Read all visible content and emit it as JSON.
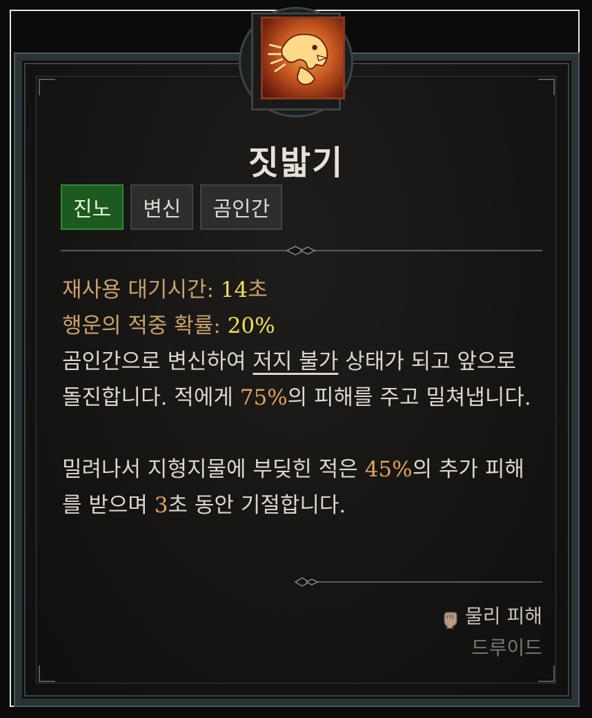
{
  "skill": {
    "name": "짓밟기",
    "icon": "bear-roar-icon"
  },
  "tags": [
    "진노",
    "변신",
    "곰인간"
  ],
  "stats": {
    "cooldown_label": "재사용 대기시간: ",
    "cooldown_value": "14",
    "cooldown_unit": "초",
    "lucky_hit_label": "행운의 적중 확률: ",
    "lucky_hit_value": "20%"
  },
  "description": {
    "p1_a": "곰인간으로 변신하여 ",
    "p1_keyword": "저지 불가",
    "p1_b": " 상태가 되고 앞으로 돌진합니다. 적에게 ",
    "p1_damage": "75%",
    "p1_c": "의 피해를 주고 밀쳐냅니다.",
    "p2_a": "밀려나서 지형지물에 부딪힌 적은 ",
    "p2_damage": "45%",
    "p2_b": "의 추가 피해를 받으며 ",
    "p2_duration": "3",
    "p2_c": "초 동안 기절합니다."
  },
  "footer": {
    "damage_type": "물리 피해",
    "damage_icon": "fist-icon",
    "class_name": "드루이드"
  },
  "colors": {
    "active_tag": "#1d5a1f",
    "label_gold": "#c9a26b",
    "value_yellow": "#f3e05a",
    "highlight_orange": "#e1a35c"
  }
}
